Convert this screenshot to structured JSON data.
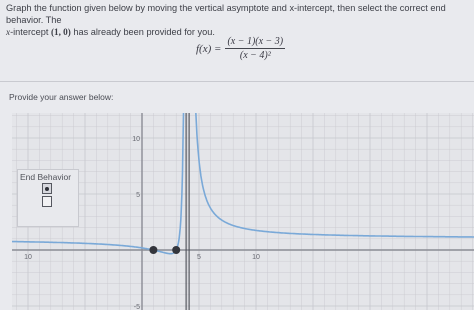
{
  "prompt": {
    "line1": "Graph the function given below by moving the vertical asymptote and x-intercept, then select the correct end behavior. The",
    "line2_pre": "x",
    "line2_mid": "-intercept ",
    "line2_point": "(1, 0)",
    "line2_post": " has already been provided for you."
  },
  "formula": {
    "lhs": "f(x) =",
    "numerator": "(x − 1)(x − 3)",
    "denominator": "(x − 4)²"
  },
  "answer_prompt": "Provide your answer below:",
  "graph": {
    "legend_title": "End Behavior",
    "x_ticks": [
      "10",
      "5",
      "10"
    ],
    "y_ticks": [
      "10",
      "5",
      "-5"
    ],
    "vertical_asymptote_x": 4,
    "intercept_points": [
      1,
      3
    ],
    "colors": {
      "curve": "#7aa9d8",
      "asymptote": "#4a4c55",
      "axis": "#8a8c94",
      "grid": "#c6c7cd",
      "point": "#33353c"
    }
  }
}
